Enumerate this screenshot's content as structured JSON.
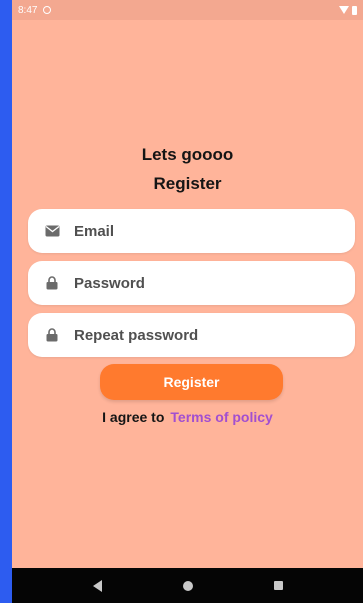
{
  "status_bar": {
    "time": "8:47"
  },
  "screen": {
    "title_line1": "Lets goooo",
    "title_line2": "Register"
  },
  "fields": {
    "email": {
      "placeholder": "Email",
      "icon": "mail-icon"
    },
    "password": {
      "placeholder": "Password",
      "icon": "lock-icon"
    },
    "repeat_password": {
      "placeholder": "Repeat password",
      "icon": "lock-icon"
    }
  },
  "register_button": {
    "label": "Register"
  },
  "agreement": {
    "text": "I agree to",
    "link_label": "Terms of policy"
  },
  "nav_bar": {
    "icons": [
      "back-icon",
      "home-icon",
      "recents-icon"
    ]
  },
  "colors": {
    "background": "#ffb49a",
    "frame": "#2d5cf0",
    "button": "#ff7a2e",
    "link": "#a24fd0"
  }
}
